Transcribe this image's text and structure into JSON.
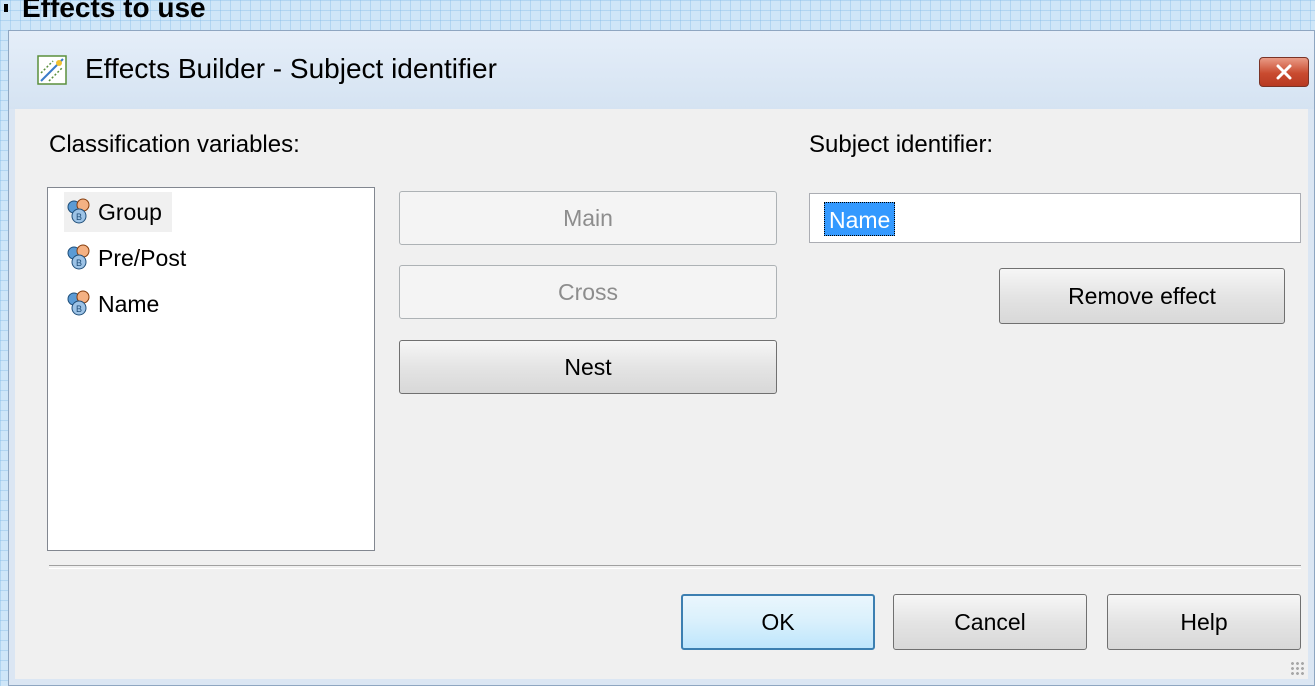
{
  "background": {
    "label": "Effects to use"
  },
  "dialog": {
    "title": "Effects Builder - Subject identifier",
    "title_icon": "effects-builder-icon",
    "close_icon": "close-icon"
  },
  "classification": {
    "label": "Classification variables:",
    "items": [
      {
        "label": "Group",
        "icon": "classification-variable-icon",
        "highlighted": true
      },
      {
        "label": "Pre/Post",
        "icon": "classification-variable-icon",
        "highlighted": false
      },
      {
        "label": "Name",
        "icon": "classification-variable-icon",
        "highlighted": false
      }
    ]
  },
  "actions": {
    "main": {
      "label": "Main",
      "enabled": false
    },
    "cross": {
      "label": "Cross",
      "enabled": false
    },
    "nest": {
      "label": "Nest",
      "enabled": true
    }
  },
  "subject": {
    "label": "Subject identifier:",
    "value": "Name",
    "remove_label": "Remove effect"
  },
  "footer": {
    "ok_label": "OK",
    "cancel_label": "Cancel",
    "help_label": "Help"
  },
  "colors": {
    "selection": "#3399ff",
    "default_button_border": "#3c7fb1",
    "close_button": "#c94b2f"
  }
}
